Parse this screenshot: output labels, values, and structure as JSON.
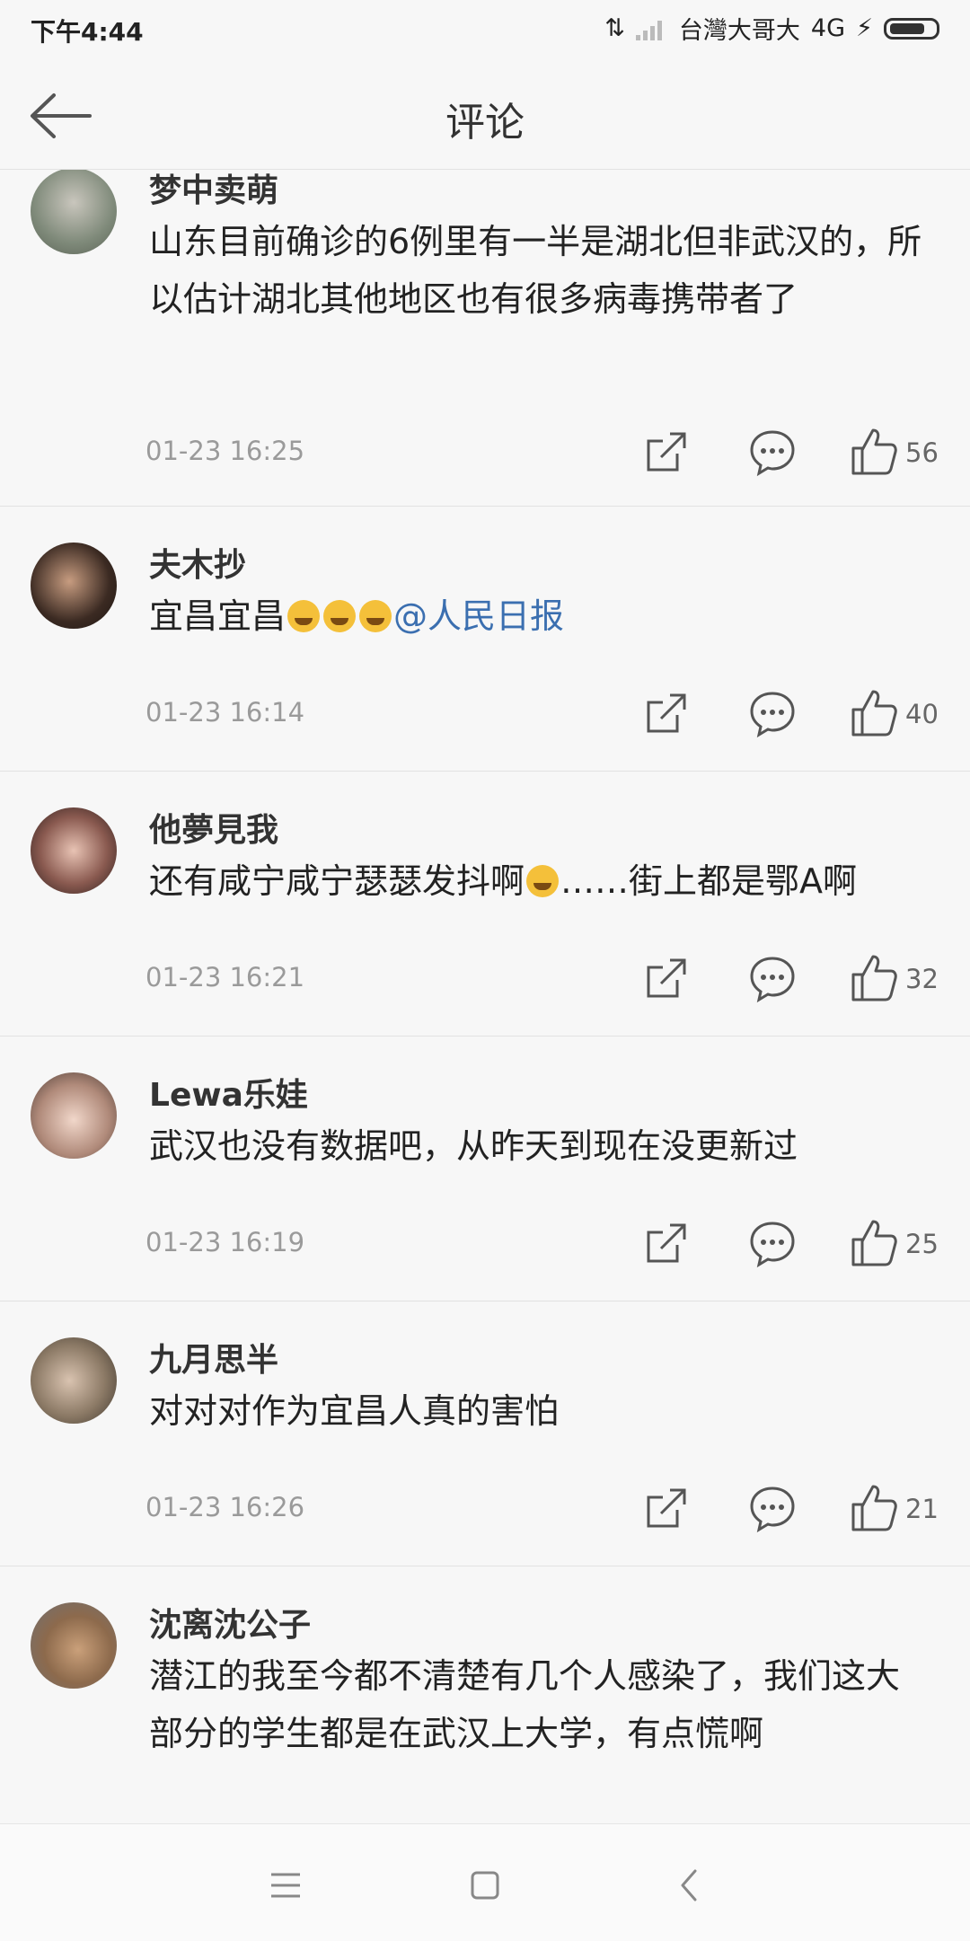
{
  "status_bar": {
    "time": "下午4:44",
    "carrier": "台灣大哥大",
    "network": "4G"
  },
  "navbar": {
    "title": "评论"
  },
  "comments": [
    {
      "username": "梦中卖萌",
      "text": "山东目前确诊的6例里有一半是湖北但非武汉的，所以估计湖北其他地区也有很多病毒携带者了",
      "time": "01-23 16:25",
      "likes": "56"
    },
    {
      "username": "夫木抄",
      "text": "宜昌宜昌",
      "mention": "@人民日报",
      "time": "01-23 16:14",
      "likes": "40"
    },
    {
      "username": "他夢見我",
      "text_before": "还有咸宁咸宁瑟瑟发抖啊",
      "text_after": "……街上都是鄂A啊",
      "time": "01-23 16:21",
      "likes": "32"
    },
    {
      "username": "Lewa乐娃",
      "text": "武汉也没有数据吧，从昨天到现在没更新过",
      "time": "01-23 16:19",
      "likes": "25"
    },
    {
      "username": "九月思半",
      "text": "对对对作为宜昌人真的害怕",
      "time": "01-23 16:26",
      "likes": "21"
    },
    {
      "username": "沈离沈公子",
      "text": "潜江的我至今都不清楚有几个人感染了，我们这大部分的学生都是在武汉上大学，有点慌啊"
    }
  ]
}
